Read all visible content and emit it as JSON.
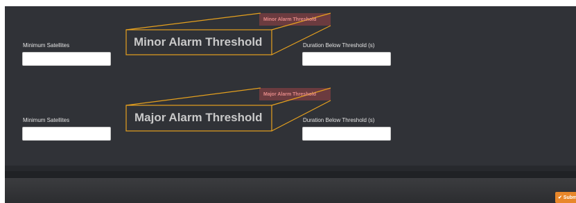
{
  "sections": [
    {
      "callout_title": "Minor Alarm Threshold",
      "callout_tag": "Minor Alarm Threshold",
      "min_sat_label": "Minimum Satellites",
      "min_sat_value": "",
      "duration_label": "Duration Below Threshold (s)",
      "duration_value": ""
    },
    {
      "callout_title": "Major Alarm Threshold",
      "callout_tag": "Major Alarm Threshold",
      "min_sat_label": "Minimum Satellites",
      "min_sat_value": "",
      "duration_label": "Duration Below Threshold (s)",
      "duration_value": ""
    }
  ],
  "footer": {
    "submit_label": "✔ Submit"
  },
  "colors": {
    "panel_bg": "#303237",
    "callout_outline": "#e6a11e",
    "callout_tag_bg": "#6b3b3f",
    "submit_bg": "#e8872a"
  }
}
